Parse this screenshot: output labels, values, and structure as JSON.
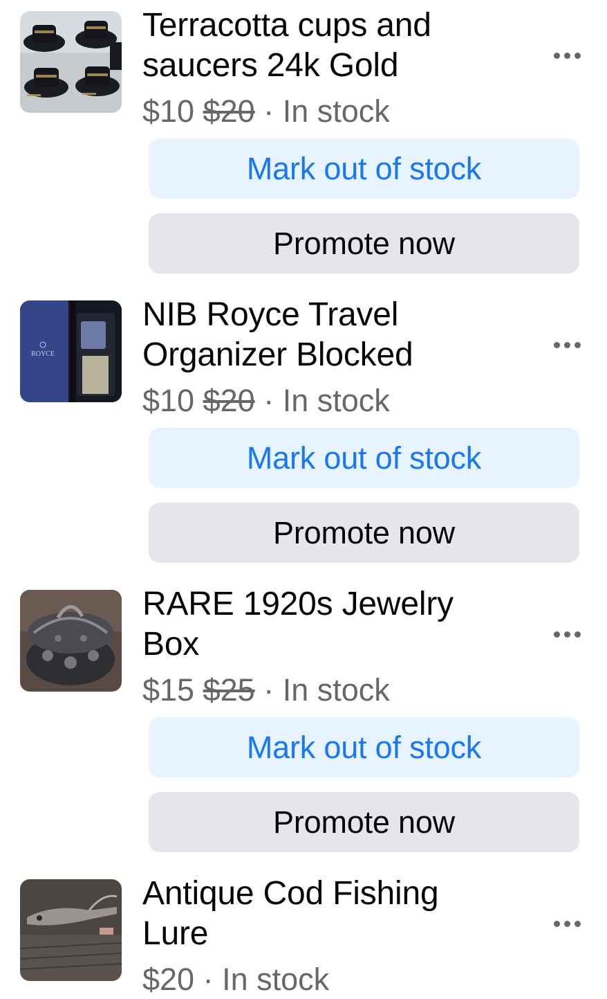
{
  "listings": [
    {
      "title_line1": "Terracotta cups and",
      "title_line2": "saucers 24k Gold",
      "price": "$10",
      "original_price": "$20",
      "status": "In stock",
      "thumbnail_icon": "cups-and-saucers-photo",
      "primary_action": "Mark out of stock",
      "secondary_action": "Promote now"
    },
    {
      "title_line1": "NIB Royce Travel",
      "title_line2": "Organizer Blocked",
      "price": "$10",
      "original_price": "$20",
      "status": "In stock",
      "thumbnail_icon": "travel-organizer-photo",
      "thumbnail_brand_text": "ROYCE",
      "primary_action": "Mark out of stock",
      "secondary_action": "Promote now"
    },
    {
      "title_line1": "RARE 1920s Jewelry",
      "title_line2": "Box",
      "price": "$15",
      "original_price": "$25",
      "status": "In stock",
      "thumbnail_icon": "jewelry-box-photo",
      "primary_action": "Mark out of stock",
      "secondary_action": "Promote now"
    },
    {
      "title_line1": "Antique Cod Fishing",
      "title_line2": "Lure",
      "price": "$20",
      "status": "In stock",
      "thumbnail_icon": "fishing-lure-photo"
    }
  ],
  "separator": "·",
  "more_icon": "more-options-icon",
  "colors": {
    "primary_button_bg": "#e7f3ff",
    "primary_button_text": "#1877f2",
    "secondary_button_bg": "#e4e6eb",
    "secondary_text": "#65676b"
  }
}
